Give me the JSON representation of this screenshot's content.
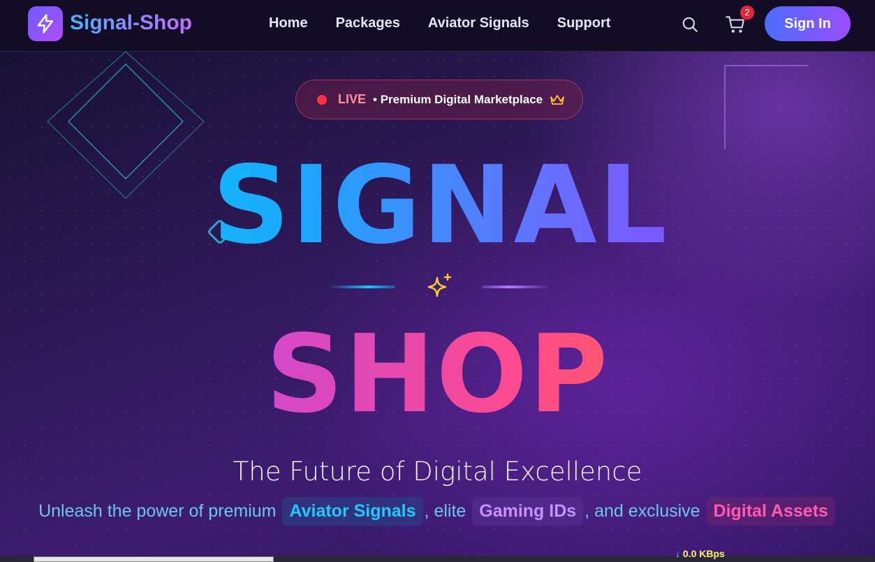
{
  "nav": {
    "brand": "Signal-Shop",
    "links": [
      "Home",
      "Packages",
      "Aviator Signals",
      "Support"
    ],
    "cart_count": "2",
    "signin_label": "Sign In"
  },
  "hero": {
    "live_label": "LIVE",
    "live_subtitle": "• Premium Digital Marketplace",
    "title_line1": "SIGNAL",
    "title_line2": "SHOP",
    "tagline": "The Future of Digital Excellence",
    "subline": {
      "part1": "Unleash the power of premium",
      "chip1": "Aviator Signals",
      "part2": ", elite",
      "chip2": "Gaming IDs",
      "part3": ", and exclusive",
      "chip3": "Digital Assets"
    }
  },
  "system": {
    "net_speed": "0.0 KBps"
  },
  "colors": {
    "accent_cyan": "#00d9f5",
    "accent_purple": "#9b2cff",
    "accent_pink": "#ff4a8d",
    "accent_orange": "#ff7a1a",
    "live_red": "#ff3344"
  },
  "icons": [
    "bolt-icon",
    "search-icon",
    "cart-icon",
    "live-dot-icon",
    "crown-icon",
    "sparkle-icon"
  ]
}
